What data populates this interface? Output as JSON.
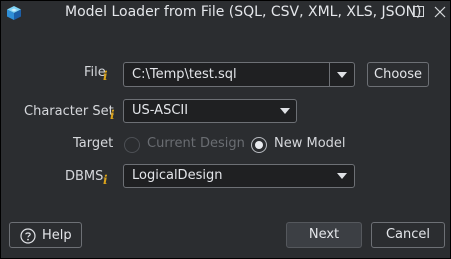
{
  "window": {
    "title": "Model Loader from File (SQL, CSV, XML, XLS, JSON)"
  },
  "form": {
    "file": {
      "label": "File",
      "value": "C:\\Temp\\test.sql",
      "choose_label": "Choose"
    },
    "character_set": {
      "label": "Character Set",
      "value": "US-ASCII"
    },
    "target": {
      "label": "Target",
      "options": [
        {
          "label": "Current Design",
          "selected": false,
          "enabled": false
        },
        {
          "label": "New Model",
          "selected": true,
          "enabled": true
        }
      ]
    },
    "dbms": {
      "label": "DBMS",
      "value": "LogicalDesign"
    },
    "info_glyph": "i"
  },
  "footer": {
    "help_label": "Help",
    "next_label": "Next",
    "cancel_label": "Cancel"
  },
  "colors": {
    "background": "#2b2d30",
    "info_icon": "#d9a21b",
    "field_background": "#1f2022"
  },
  "icons": {
    "app": "cube-app-icon",
    "maximize": "maximize-icon",
    "close": "close-icon",
    "help": "question-circle-icon"
  }
}
